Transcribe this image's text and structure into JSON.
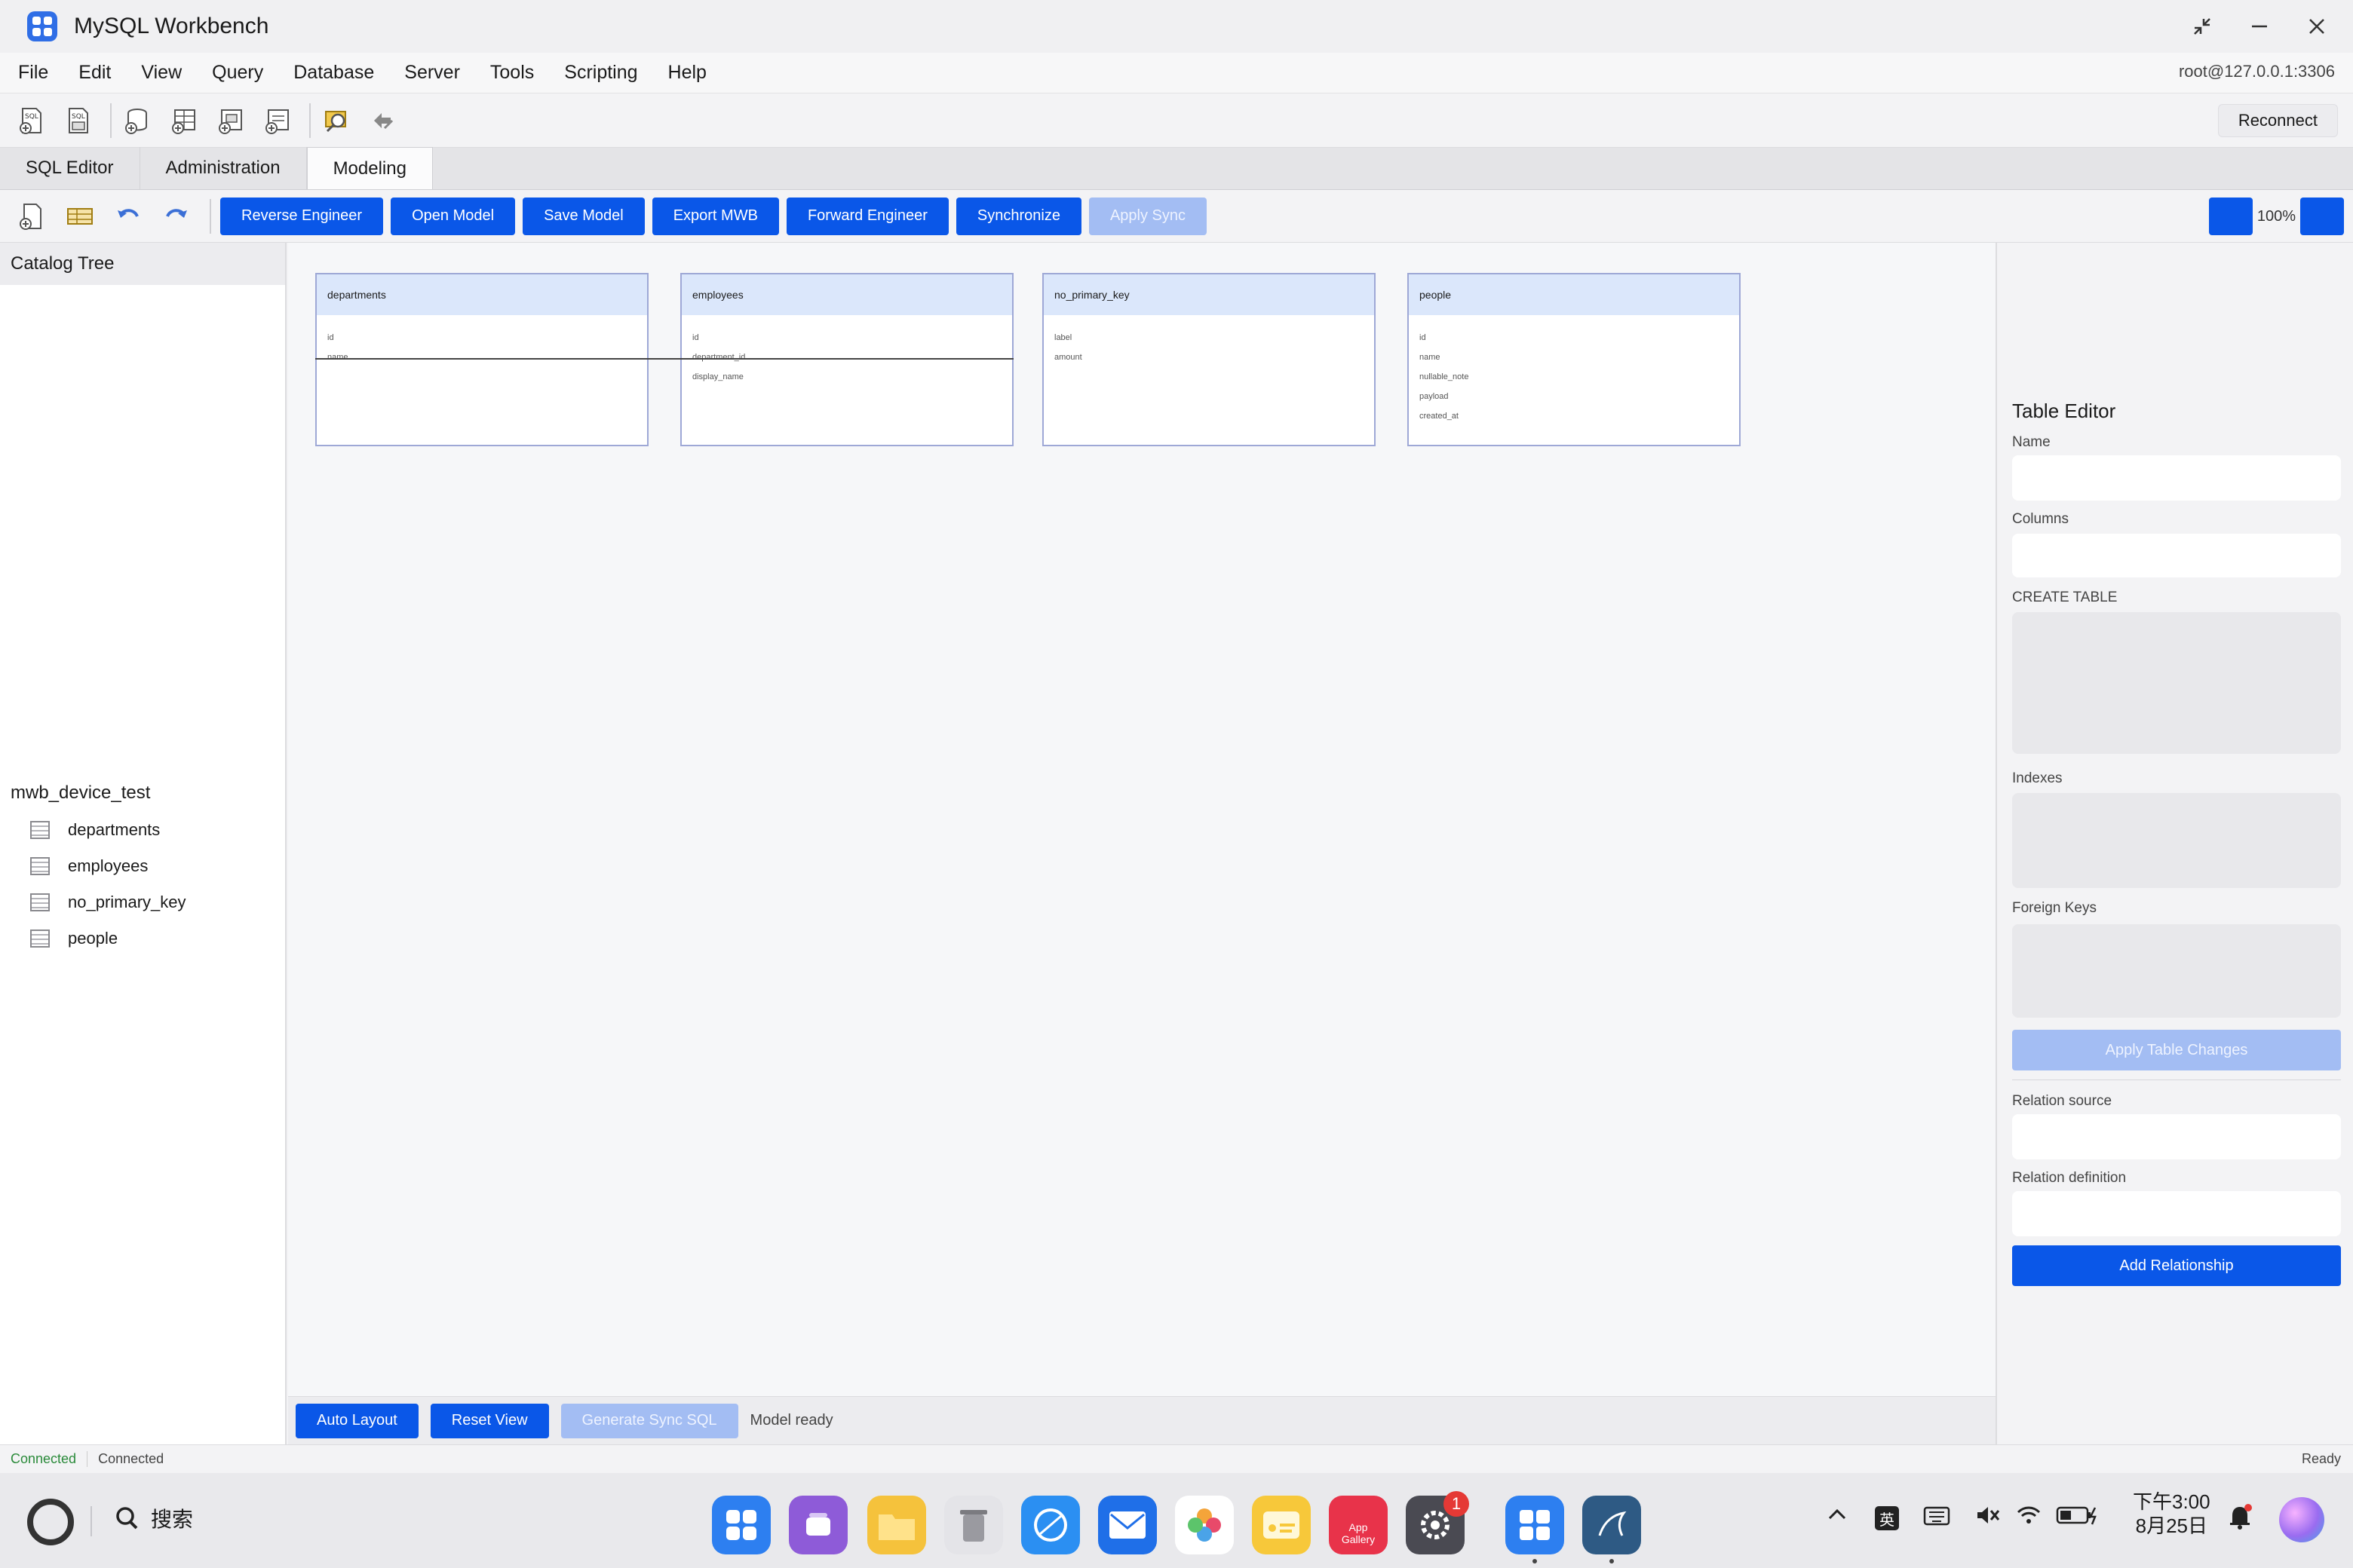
{
  "window": {
    "title": "MySQL Workbench"
  },
  "menu": [
    "File",
    "Edit",
    "View",
    "Query",
    "Database",
    "Server",
    "Tools",
    "Scripting",
    "Help"
  ],
  "connection": "root@127.0.0.1:3306",
  "toolbar": {
    "reconnect_label": "Reconnect"
  },
  "tabs": [
    "SQL Editor",
    "Administration",
    "Modeling"
  ],
  "modeling_toolbar": {
    "buttons": [
      "Reverse Engineer",
      "Open Model",
      "Save Model",
      "Export MWB",
      "Forward Engineer",
      "Synchronize",
      "Apply Sync"
    ],
    "zoom": "100%"
  },
  "catalog": {
    "header": "Catalog Tree",
    "schema": "mwb_device_test",
    "tables": [
      "departments",
      "employees",
      "no_primary_key",
      "people"
    ]
  },
  "diagram": {
    "entities": [
      {
        "name": "departments",
        "columns": [
          "id",
          "name"
        ]
      },
      {
        "name": "employees",
        "columns": [
          "id",
          "department_id",
          "display_name"
        ]
      },
      {
        "name": "no_primary_key",
        "columns": [
          "label",
          "amount"
        ]
      },
      {
        "name": "people",
        "columns": [
          "id",
          "name",
          "nullable_note",
          "payload",
          "created_at"
        ]
      }
    ]
  },
  "bottom": {
    "auto_layout": "Auto Layout",
    "reset_view": "Reset View",
    "generate_sync": "Generate Sync SQL",
    "status": "Model ready"
  },
  "table_editor": {
    "title": "Table Editor",
    "name_label": "Name",
    "columns_label": "Columns",
    "create_label": "CREATE TABLE",
    "indexes_label": "Indexes",
    "fks_label": "Foreign Keys",
    "apply_label": "Apply Table Changes",
    "relation_source_label": "Relation source",
    "relation_def_label": "Relation definition",
    "add_rel_label": "Add Relationship"
  },
  "statusbar": {
    "left1": "Connected",
    "left2": "Connected",
    "right": "Ready"
  },
  "taskbar": {
    "search": "搜索",
    "badge": "1",
    "app_gallery": "App Gallery",
    "ime": "英",
    "time": "下午3:00",
    "date": "8月25日"
  },
  "colors": {
    "accent": "#0a57e8",
    "accent_disabled": "#a3bdf3",
    "entity_header": "#dbe7fb"
  }
}
